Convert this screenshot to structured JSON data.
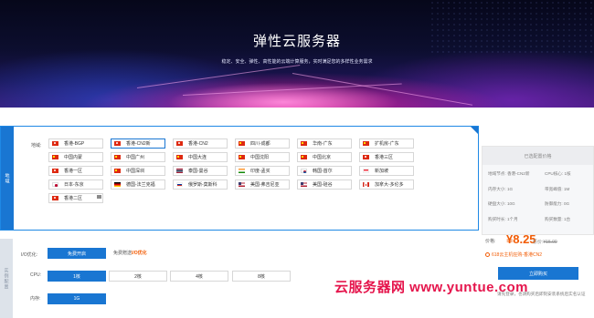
{
  "banner": {
    "title": "弹性云服务器",
    "subtitle": "稳定、安全、弹性、高性能的云端计算服务，实时满足您的多样性业务需求"
  },
  "region": {
    "side_label": "地域",
    "field_label": "地域:",
    "items": [
      {
        "label": "香港-BGP",
        "flag": "hk"
      },
      {
        "label": "香港-CN2新",
        "flag": "hk"
      },
      {
        "label": "香港-CN2",
        "flag": "hk"
      },
      {
        "label": "四川-成都",
        "flag": "cn"
      },
      {
        "label": "华南-广东",
        "flag": "cn"
      },
      {
        "label": "扩机房-广东",
        "flag": "cn"
      },
      {
        "label": "中国内蒙",
        "flag": "cn"
      },
      {
        "label": "中国广州",
        "flag": "cn"
      },
      {
        "label": "中国大连",
        "flag": "cn"
      },
      {
        "label": "中国沈阳",
        "flag": "cn"
      },
      {
        "label": "中国北京",
        "flag": "cn"
      },
      {
        "label": "香港三区",
        "flag": "hk"
      },
      {
        "label": "香港一区",
        "flag": "hk"
      },
      {
        "label": "中国深圳",
        "flag": "cn"
      },
      {
        "label": "泰国-曼谷",
        "flag": "th"
      },
      {
        "label": "印度-孟买",
        "flag": "in"
      },
      {
        "label": "韩国-首尔",
        "flag": "kr"
      },
      {
        "label": "新加坡",
        "flag": "sg"
      },
      {
        "label": "日本-东京",
        "flag": "jp"
      },
      {
        "label": "德国-法兰克福",
        "flag": "de"
      },
      {
        "label": "俄罗斯-莫斯科",
        "flag": "ru"
      },
      {
        "label": "美国-弗吉尼亚",
        "flag": "us"
      },
      {
        "label": "美国-硅谷",
        "flag": "us"
      },
      {
        "label": "加拿大-多伦多",
        "flag": "ca"
      },
      {
        "label": "香港二区",
        "flag": "hk"
      }
    ],
    "selected_index": 1
  },
  "config": {
    "side_label": "实例配置",
    "io_label": "I/O优化:",
    "io_button": "免费开启",
    "io_note_prefix": "免费赠送",
    "io_note_highlight": "I/O优化",
    "cpu_label": "CPU:",
    "cpu_options": [
      "1核",
      "2核",
      "4核",
      "8核"
    ],
    "memory_label": "内存:",
    "memory_options": [
      "1G"
    ]
  },
  "summary": {
    "header": "已选配置价格",
    "specs": [
      {
        "k": "地域节点:",
        "v": "香港-CN2新"
      },
      {
        "k": "CPU核心:",
        "v": "1核"
      },
      {
        "k": "内存大小:",
        "v": "1G"
      },
      {
        "k": "带宽峰值:",
        "v": "1M"
      },
      {
        "k": "硬盘大小:",
        "v": "10G"
      },
      {
        "k": "防御能力:",
        "v": "0G"
      },
      {
        "k": "购买时长:",
        "v": "1个月"
      },
      {
        "k": "购买数量:",
        "v": "1台"
      }
    ],
    "price_label": "价格:",
    "price": "¥8.25",
    "original_label": "原价:",
    "original_price": "¥15.00",
    "coupon": "618云主机狂购-香港CN2",
    "buy_button": "立即购买",
    "buy_note": "请先登录，也请购买后即刻安装系统后实名认证"
  },
  "watermark": "云服务器网 www.yuntue.com",
  "colors": {
    "accent": "#1976d2",
    "price": "#f25c05",
    "watermark": "#e5154c"
  }
}
